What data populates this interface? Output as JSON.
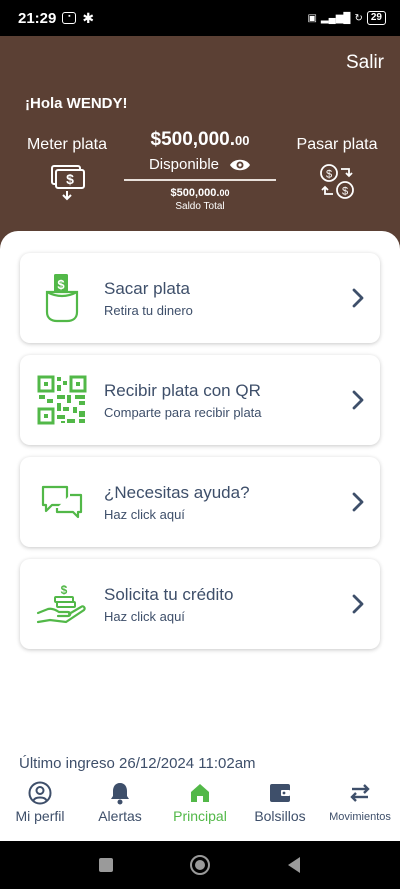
{
  "status_bar": {
    "time": "21:29",
    "battery": "29"
  },
  "header": {
    "logout_label": "Salir",
    "greeting": "¡Hola WENDY!",
    "deposit_label": "Meter plata",
    "transfer_label": "Pasar plata",
    "balance_main": "$500,000.",
    "balance_cents": "00",
    "available_label": "Disponible",
    "total_main": "$500,000.",
    "total_cents": "00",
    "total_label": "Saldo Total"
  },
  "cards": [
    {
      "title": "Sacar plata",
      "subtitle": "Retira tu dinero",
      "icon": "wallet-cash-icon"
    },
    {
      "title": "Recibir plata con QR",
      "subtitle": "Comparte para recibir plata",
      "icon": "qr-code-icon"
    },
    {
      "title": "¿Necesitas ayuda?",
      "subtitle": "Haz click aquí",
      "icon": "chat-bubbles-icon"
    },
    {
      "title": "Solicita tu crédito",
      "subtitle": "Haz click aquí",
      "icon": "hand-money-icon"
    }
  ],
  "last_login": "Último ingreso 26/12/2024 11:02am",
  "bottom_nav": [
    {
      "label": "Mi perfil",
      "icon": "user-icon",
      "active": false
    },
    {
      "label": "Alertas",
      "icon": "bell-icon",
      "active": false
    },
    {
      "label": "Principal",
      "icon": "home-icon",
      "active": true
    },
    {
      "label": "Bolsillos",
      "icon": "wallet-icon",
      "active": false
    },
    {
      "label": "Movimientos",
      "icon": "arrows-icon",
      "active": false
    }
  ],
  "colors": {
    "header_bg": "#5b4034",
    "accent_green": "#52b848",
    "text_blue": "#3e4f6a"
  }
}
